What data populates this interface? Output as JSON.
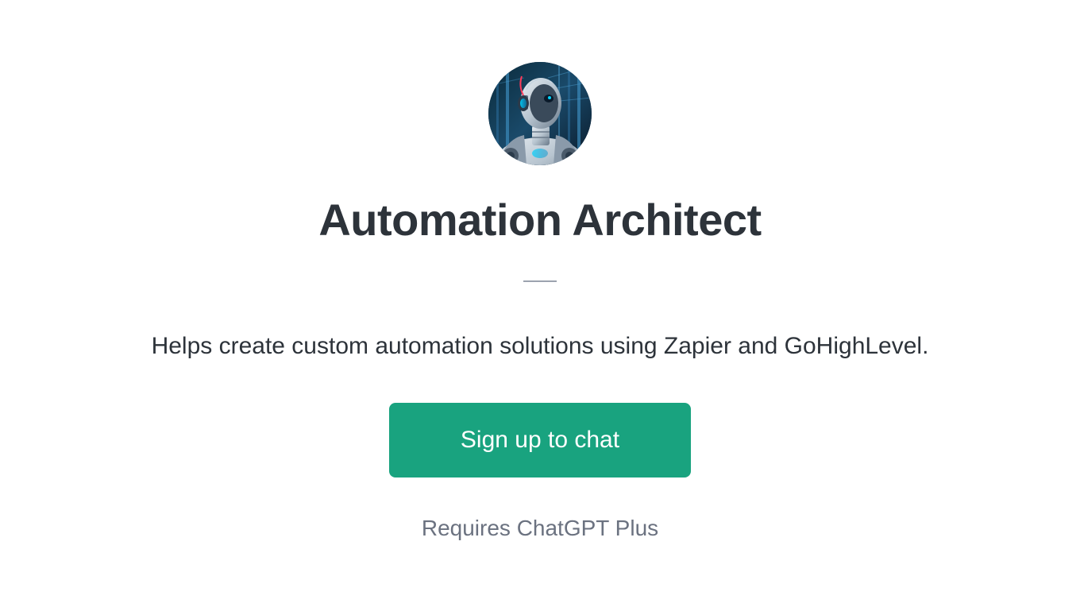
{
  "title": "Automation Architect",
  "description": "Helps create custom automation solutions using Zapier and GoHighLevel.",
  "signup_button_label": "Sign up to chat",
  "requires_text": "Requires ChatGPT Plus",
  "colors": {
    "accent": "#19a37f",
    "text_primary": "#2d333a",
    "text_secondary": "#6b7280"
  }
}
